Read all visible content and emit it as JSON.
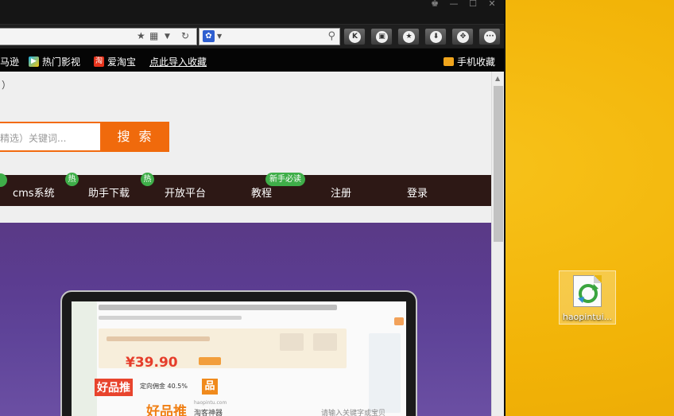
{
  "browser": {
    "window_buttons": [
      "♚",
      "—",
      "☐",
      "✕"
    ],
    "toolbar_buttons": [
      {
        "name": "k-button",
        "glyph": "K"
      },
      {
        "name": "lock-button",
        "glyph": "🔒"
      },
      {
        "name": "favorite-button",
        "glyph": "★"
      },
      {
        "name": "download-button",
        "glyph": "⬇"
      },
      {
        "name": "game-button",
        "glyph": "🎮"
      },
      {
        "name": "more-button",
        "glyph": "···"
      }
    ],
    "favorites": [
      {
        "label": "马逊",
        "icon": "amazon-icon"
      },
      {
        "label": "热门影视",
        "icon": "video-icon"
      },
      {
        "label": "爱淘宝",
        "icon": "taobao-icon",
        "mark": "淘"
      },
      {
        "label": "点此导入收藏",
        "icon": ""
      }
    ],
    "favorites_folder": "手机收藏"
  },
  "page": {
    "paren": "）",
    "search_placeholder": "精选）关键词...",
    "search_button": "搜 索",
    "nav": [
      {
        "label": "cms系统"
      },
      {
        "label": "助手下载"
      },
      {
        "label": "开放平台"
      },
      {
        "label": "教程"
      },
      {
        "label": "注册"
      },
      {
        "label": "登录"
      }
    ],
    "badges": {
      "hot": "热",
      "newbie": "新手必读"
    },
    "banner": {
      "price": "¥39.90",
      "brand1": "好品推",
      "brand_badge": "品",
      "commission": "定向佣金 40.5%",
      "brand2": "好品推",
      "brand2_url": "haopintu.com",
      "brand2_sub": "淘客神器",
      "hint": "请输入关键字或宝贝"
    }
  },
  "desktop": {
    "icon_label": "haopintui..."
  },
  "colors": {
    "accent": "#f06a0c",
    "nav_bg": "#2d1815",
    "hot_badge": "#3fae49",
    "banner": "#5b3c90"
  }
}
